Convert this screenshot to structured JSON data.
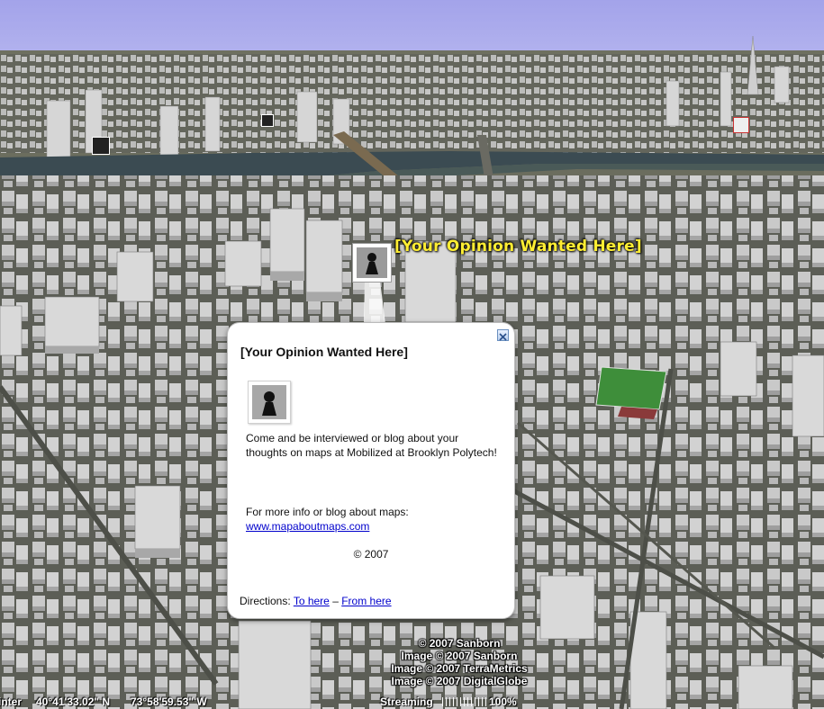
{
  "placemark": {
    "label": "[Your Opinion Wanted Here]"
  },
  "balloon": {
    "title": "[Your Opinion Wanted Here]",
    "body": "Come and be interviewed or blog about your thoughts on maps at Mobilized at Brooklyn Polytech!",
    "info_text": "For more info or blog about maps:",
    "link_text": "www.mapaboutmaps.com",
    "copyright": "© 2007",
    "directions_label": "Directions:",
    "to_here": "To here",
    "separator": "–",
    "from_here": "From here"
  },
  "credits": [
    "© 2007 Sanborn",
    "Image © 2007 Sanborn",
    "Image © 2007 TerraMetrics",
    "Image © 2007 DigitalGlobe"
  ],
  "status": {
    "pointer_label": "inter",
    "latitude": "40°41'33.02\" N",
    "longitude": "73°58'59.53\" W",
    "streaming_label": "Streaming",
    "streaming_percent": "100%",
    "streaming_progress": 1.0
  },
  "colors": {
    "sky": "#a8a8e8",
    "water": "#3a4a52",
    "label_yellow": "#ffee33",
    "link_blue": "#0000cc"
  }
}
